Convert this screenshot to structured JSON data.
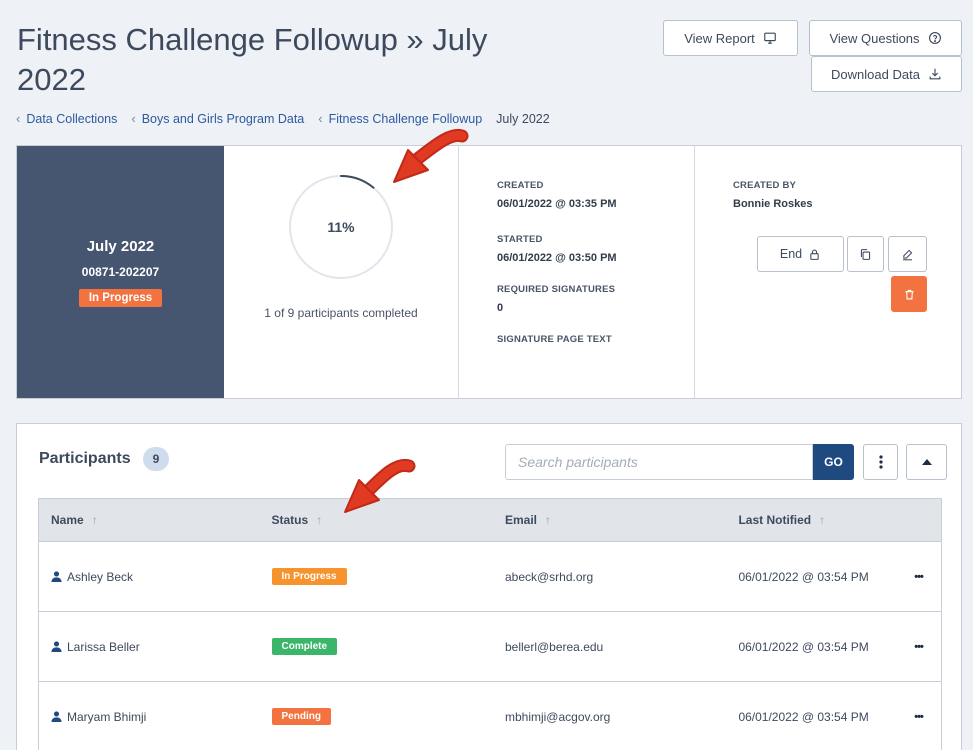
{
  "header": {
    "title": "Fitness Challenge Followup » July 2022",
    "view_report": "View Report",
    "view_questions": "View Questions",
    "download_data": "Download Data"
  },
  "breadcrumb": {
    "items": [
      "Data Collections",
      "Boys and Girls Program Data",
      "Fitness Challenge Followup"
    ],
    "current": "July 2022"
  },
  "summary": {
    "name": "July 2022",
    "code": "00871-202207",
    "status": "In Progress",
    "progress_percent": 11,
    "progress_label": "11%",
    "progress_text": "1 of 9 participants completed",
    "created_label": "CREATED",
    "created_value": "06/01/2022 @ 03:35 PM",
    "started_label": "STARTED",
    "started_value": "06/01/2022 @ 03:50 PM",
    "signatures_label": "REQUIRED SIGNATURES",
    "signatures_value": "0",
    "sigtext_label": "SIGNATURE PAGE TEXT",
    "created_by_label": "CREATED BY",
    "created_by_value": "Bonnie Roskes",
    "end_label": "End"
  },
  "participants": {
    "title": "Participants",
    "count": "9",
    "search_placeholder": "Search participants",
    "go_label": "GO",
    "columns": [
      "Name",
      "Status",
      "Email",
      "Last Notified"
    ],
    "sort_indicator": "↑",
    "more_indicator": "•••",
    "rows": [
      {
        "name": "Ashley Beck",
        "status": "In Progress",
        "email": "abeck@srhd.org",
        "notified": "06/01/2022 @ 03:54 PM"
      },
      {
        "name": "Larissa Beller",
        "status": "Complete",
        "email": "bellerl@berea.edu",
        "notified": "06/01/2022 @ 03:54 PM"
      },
      {
        "name": "Maryam Bhimji",
        "status": "Pending",
        "email": "mbhimji@acgov.org",
        "notified": "06/01/2022 @ 03:54 PM"
      }
    ]
  },
  "colors": {
    "accent": "#1f4a80",
    "in_progress": "#f7932d",
    "complete": "#3bb56a",
    "pending": "#f2733f",
    "annotation_arrow": "#d9301e"
  }
}
